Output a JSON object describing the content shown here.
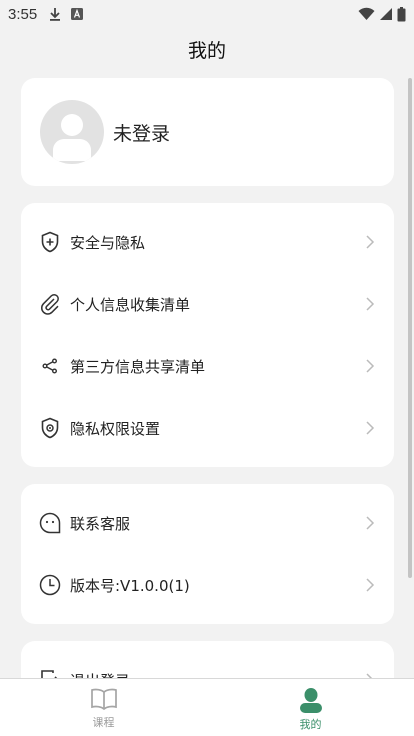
{
  "status_bar": {
    "time": "3:55",
    "left_icons": [
      "download-icon",
      "a-badge-icon"
    ],
    "right_icons": [
      "wifi-icon",
      "signal-icon",
      "battery-icon"
    ]
  },
  "header": {
    "title": "我的"
  },
  "profile": {
    "login_label": "未登录"
  },
  "privacy_menu": [
    {
      "label": "安全与隐私",
      "icon": "shield-plus-icon"
    },
    {
      "label": "个人信息收集清单",
      "icon": "paperclip-icon"
    },
    {
      "label": "第三方信息共享清单",
      "icon": "share-icon"
    },
    {
      "label": "隐私权限设置",
      "icon": "shield-gear-icon"
    }
  ],
  "support_menu": [
    {
      "label": "联系客服",
      "icon": "chat-bubble-icon"
    },
    {
      "label": "版本号:V1.0.0(1)",
      "icon": "clock-icon"
    }
  ],
  "logout_menu": [
    {
      "label": "退出登录",
      "icon": "logout-icon"
    }
  ],
  "tab_bar": {
    "tabs": [
      {
        "label": "课程",
        "icon": "book-icon",
        "active": false
      },
      {
        "label": "我的",
        "icon": "person-icon",
        "active": true
      }
    ]
  },
  "colors": {
    "accent": "#3b8f6a",
    "inactive": "#9a9a9a",
    "background": "#f2f2f2"
  }
}
